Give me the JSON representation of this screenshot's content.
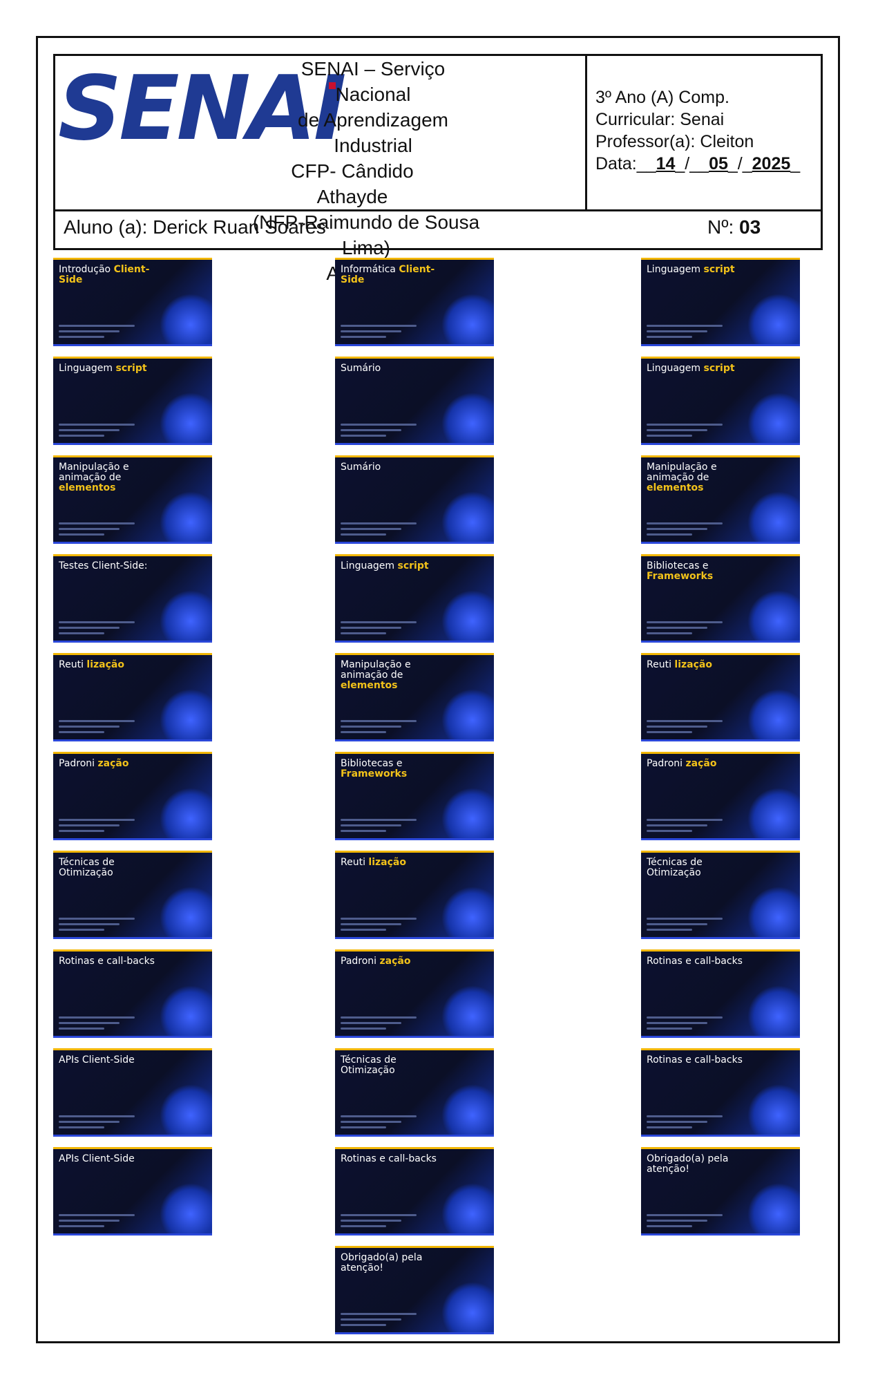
{
  "header": {
    "logo_text": "SENAI",
    "school_lines": [
      "SENAI – Serviço Nacional",
      "de Aprendizagem",
      "Industrial",
      "CFP- Cândido Athayde",
      "(NFP-Raimundo de Sousa Lima)",
      "Atividade"
    ],
    "info_lines": [
      "3º Ano (A) Comp.",
      "Curricular: Senai",
      "Professor(a): Cleiton"
    ],
    "date_label": "Data:",
    "date_day": "14",
    "date_month": "05",
    "date_year": "2025",
    "student_label": "Aluno (a): Derick Ruan Soares",
    "number_label": "Nº:",
    "number_value": "03"
  },
  "slides": [
    {
      "pre": "Introdução",
      "hl": "Client-Side"
    },
    {
      "pre": "Informática",
      "hl": "Client-Side"
    },
    {
      "pre": "Linguagem",
      "hl": "script"
    },
    {
      "pre": "Linguagem",
      "hl": "script"
    },
    {
      "pre": "Sumário",
      "hl": ""
    },
    {
      "pre": "Linguagem",
      "hl": "script"
    },
    {
      "pre": "Manipulação e animação de",
      "hl": "elementos"
    },
    {
      "pre": "Sumário",
      "hl": ""
    },
    {
      "pre": "Manipulação e animação de",
      "hl": "elementos"
    },
    {
      "pre": "Testes Client-Side:",
      "hl": ""
    },
    {
      "pre": "Linguagem",
      "hl": "script"
    },
    {
      "pre": "Bibliotecas e",
      "hl": "Frameworks"
    },
    {
      "pre": "Reuti",
      "hl": "lização"
    },
    {
      "pre": "Manipulação e animação de",
      "hl": "elementos"
    },
    {
      "pre": "Reuti",
      "hl": "lização"
    },
    {
      "pre": "Padroni",
      "hl": "zação"
    },
    {
      "pre": "Bibliotecas e",
      "hl": "Frameworks"
    },
    {
      "pre": "Padroni",
      "hl": "zação"
    },
    {
      "pre": "Técnicas de Otimização",
      "hl": ""
    },
    {
      "pre": "Reuti",
      "hl": "lização"
    },
    {
      "pre": "Técnicas de Otimização",
      "hl": ""
    },
    {
      "pre": "Rotinas e call-backs",
      "hl": ""
    },
    {
      "pre": "Padroni",
      "hl": "zação"
    },
    {
      "pre": "Rotinas e call-backs",
      "hl": ""
    },
    {
      "pre": "APIs Client-Side",
      "hl": ""
    },
    {
      "pre": "Técnicas de Otimização",
      "hl": ""
    },
    {
      "pre": "Rotinas e call-backs",
      "hl": ""
    },
    {
      "pre": "APIs Client-Side",
      "hl": ""
    },
    {
      "pre": "Rotinas e call-backs",
      "hl": ""
    },
    {
      "pre": "Obrigado(a) pela atenção!",
      "hl": ""
    },
    {
      "pre": "Obrigado(a) pela atenção!",
      "hl": ""
    }
  ]
}
